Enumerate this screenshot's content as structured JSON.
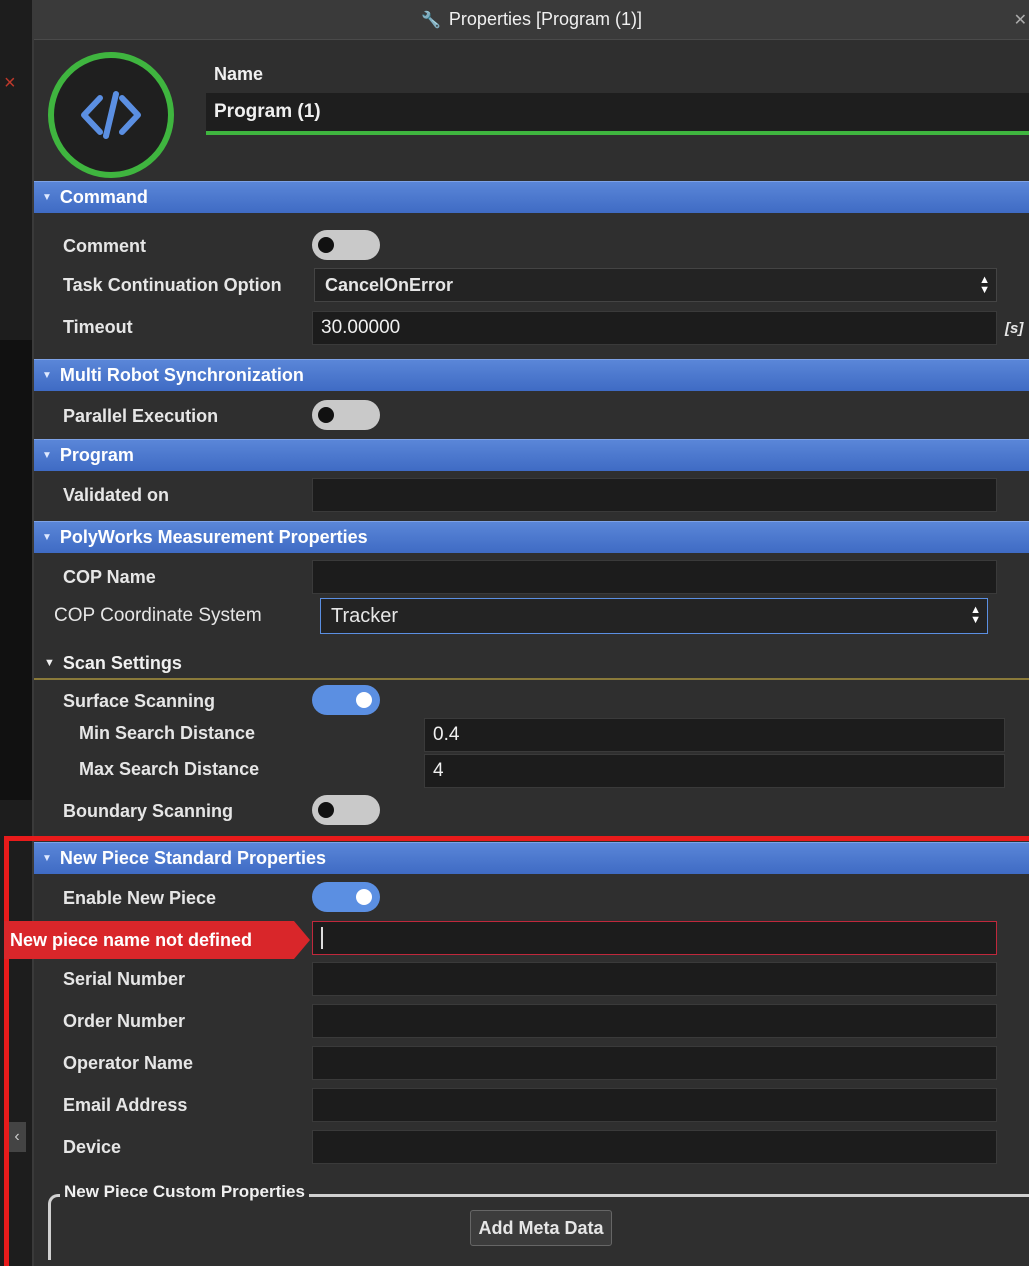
{
  "window": {
    "title": "Properties [Program (1)]"
  },
  "header": {
    "name_label": "Name",
    "name_value": "Program (1)"
  },
  "sections": {
    "command": {
      "title": "Command",
      "comment_label": "Comment",
      "comment_enabled": false,
      "task_continuation_label": "Task Continuation Option",
      "task_continuation_value": "CancelOnError",
      "timeout_label": "Timeout",
      "timeout_value": "30.00000",
      "timeout_unit": "[s]"
    },
    "multi_robot": {
      "title": "Multi Robot Synchronization",
      "parallel_label": "Parallel Execution",
      "parallel_enabled": false
    },
    "program": {
      "title": "Program",
      "validated_label": "Validated on",
      "validated_value": ""
    },
    "polyworks": {
      "title": "PolyWorks Measurement Properties",
      "cop_name_label": "COP Name",
      "cop_name_value": "",
      "cop_coord_label": "COP Coordinate System",
      "cop_coord_value": "Tracker"
    },
    "scan_settings": {
      "title": "Scan Settings",
      "surface_label": "Surface Scanning",
      "surface_enabled": true,
      "min_search_label": "Min Search Distance",
      "min_search_value": "0.4",
      "max_search_label": "Max Search Distance",
      "max_search_value": "4",
      "boundary_label": "Boundary Scanning",
      "boundary_enabled": false
    },
    "new_piece": {
      "title": "New Piece Standard Properties",
      "enable_label": "Enable New Piece",
      "enable_enabled": true,
      "error_text": "New piece name not defined",
      "piece_name_value": "",
      "serial_label": "Serial Number",
      "serial_value": "",
      "order_label": "Order Number",
      "order_value": "",
      "operator_label": "Operator Name",
      "operator_value": "",
      "email_label": "Email Address",
      "email_value": "",
      "device_label": "Device",
      "device_value": ""
    },
    "custom": {
      "title": "New Piece Custom Properties",
      "add_button": "Add Meta Data"
    }
  },
  "colors": {
    "accent_green": "#3fb53f",
    "section_blue": "#4a76cc",
    "error_red": "#e81b1b",
    "toggle_on": "#5b8fe2"
  }
}
